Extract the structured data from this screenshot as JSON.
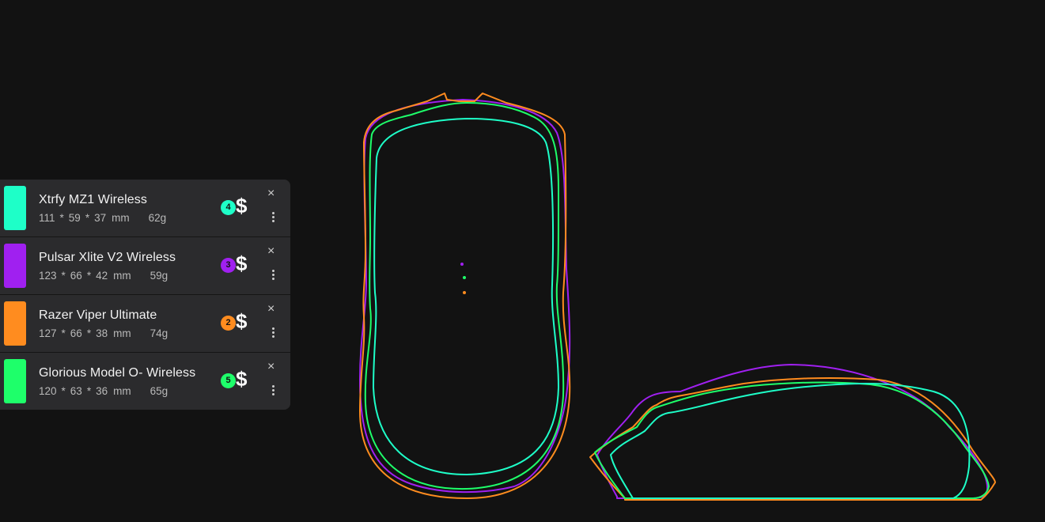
{
  "mice": [
    {
      "name": "Xtrfy MZ1 Wireless",
      "length": "111",
      "width": "59",
      "height": "37",
      "unit": "mm",
      "weight": "62g",
      "rank": "4",
      "price_symbol": "$",
      "color": "#1effc8"
    },
    {
      "name": "Pulsar Xlite V2 Wireless",
      "length": "123",
      "width": "66",
      "height": "42",
      "unit": "mm",
      "weight": "59g",
      "rank": "3",
      "price_symbol": "$",
      "color": "#a020f0"
    },
    {
      "name": "Razer Viper Ultimate",
      "length": "127",
      "width": "66",
      "height": "38",
      "unit": "mm",
      "weight": "74g",
      "rank": "2",
      "price_symbol": "$",
      "color": "#ff8c1f"
    },
    {
      "name": "Glorious Model O- Wireless",
      "length": "120",
      "width": "63",
      "height": "36",
      "unit": "mm",
      "weight": "65g",
      "rank": "5",
      "price_symbol": "$",
      "color": "#1eff6a"
    }
  ],
  "symbols": {
    "times": "*",
    "close": "×"
  },
  "icons": {
    "remove": "close-icon",
    "menu": "more-vertical-icon",
    "price": "dollar-icon"
  }
}
